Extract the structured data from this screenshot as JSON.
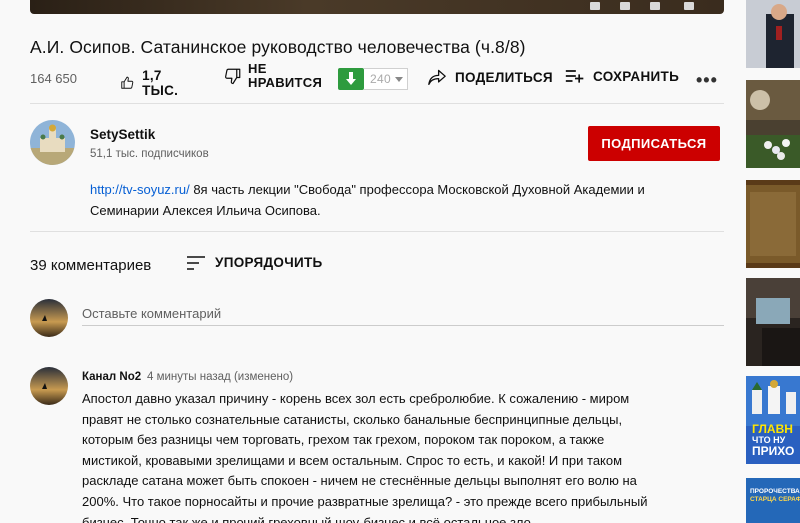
{
  "video": {
    "title": "А.И. Осипов. Сатанинское руководство человечества (ч.8/8)",
    "views": "164 650"
  },
  "actions": {
    "like_count": "1,7 ТЫС.",
    "dislike_label_line1": "НЕ",
    "dislike_label_line2": "НРАВИТСЯ",
    "extension_count": "240",
    "share_label": "ПОДЕЛИТЬСЯ",
    "save_label": "СОХРАНИТЬ",
    "more_label": "•••"
  },
  "channel": {
    "name": "SetySettik",
    "subscribers": "51,1 тыс. подписчиков",
    "subscribe_label": "ПОДПИСАТЬСЯ"
  },
  "description": {
    "link": "http://tv-soyuz.ru/",
    "text_line1": " 8я часть лекции \"Свобода\" профессора Московской Духовной Академии и",
    "text_line2": "Семинарии Алексея Ильича Осипова."
  },
  "comments": {
    "count_label": "39 комментариев",
    "sort_label": "УПОРЯДОЧИТЬ",
    "input_placeholder": "Оставьте комментарий",
    "items": [
      {
        "author": "Канал No2",
        "time": "4 минуты назад (изменено)",
        "lines": [
          "Апостол давно указал причину - корень всех зол есть сребролюбие. К сожалению - миром",
          "правят не столько сознательные сатанисты, сколько банальные беспринципные дельцы,",
          "которым без разницы чем торговать, грехом так грехом, пороком так пороком, а также",
          "мистикой, кровавыми зрелищами и всем остальным. Спрос то есть, и какой! И при таком",
          "раскладе сатана может быть спокоен - ничем не стеснённые дельцы выполнят его волю на",
          "200%. Что такое порносайты и прочие развратные зрелища? - это прежде всего прибыльный",
          "бизнес. Точно так же и прочий греховный шоу-бизнес и всё остальное зло."
        ]
      }
    ]
  },
  "sidebar": {
    "thumb5_line1": "ГЛАВН",
    "thumb5_line2": "ЧТО НУ",
    "thumb5_line3": "ПРИХО",
    "thumb6_line1": "ПРОРОЧЕСТВА",
    "thumb6_line2": "СТАРЦА СЕРАФИМ"
  },
  "colors": {
    "subscribe": "#cc0000",
    "link": "#065fd4",
    "extension_green": "#2e9b3e"
  }
}
